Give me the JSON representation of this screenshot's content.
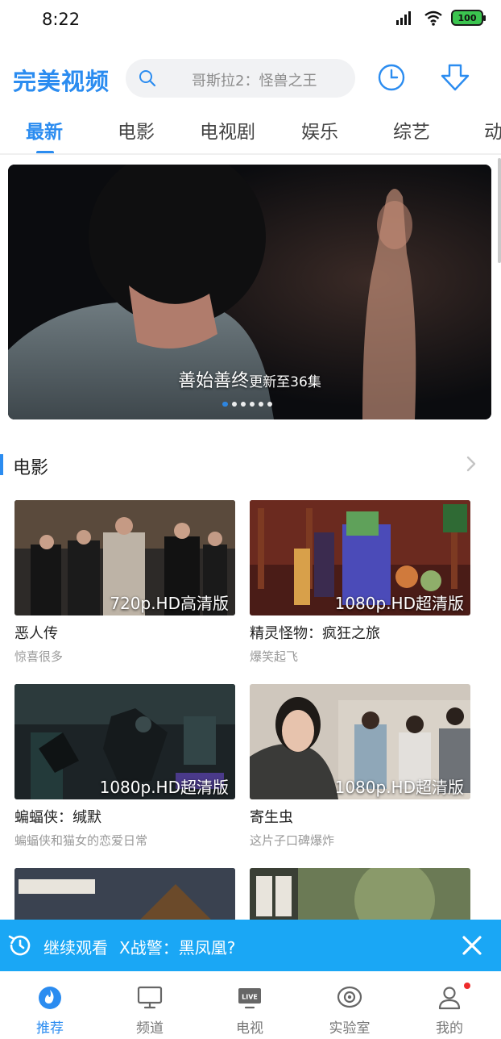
{
  "status_bar": {
    "time": "8:22",
    "battery": "100"
  },
  "header": {
    "app_title": "完美视频",
    "search_placeholder": "哥斯拉2：怪兽之王"
  },
  "tabs": [
    {
      "label": "最新",
      "active": true
    },
    {
      "label": "电影"
    },
    {
      "label": "电视剧"
    },
    {
      "label": "娱乐"
    },
    {
      "label": "综艺"
    },
    {
      "label": "动"
    }
  ],
  "banner": {
    "title": "善始善终",
    "subtitle": "更新至36集",
    "slide_count": 6,
    "active_slide": 1
  },
  "section": {
    "title": "电影"
  },
  "movies": [
    {
      "title": "恶人传",
      "subtitle": "惊喜很多",
      "quality": "720p.HD高清版"
    },
    {
      "title": "精灵怪物：疯狂之旅",
      "subtitle": "爆笑起飞",
      "quality": "1080p.HD超清版"
    },
    {
      "title": "蝙蝠侠：缄默",
      "subtitle": "蝙蝠侠和猫女的恋爱日常",
      "quality": "1080p.HD超清版"
    },
    {
      "title": "寄生虫",
      "subtitle": "这片子口碑爆炸",
      "quality": "1080p.HD超清版"
    }
  ],
  "continue_watching": {
    "label": "继续观看",
    "title": "X战警：黑凤凰?"
  },
  "bottom_nav": [
    {
      "label": "推荐",
      "icon": "flame-icon",
      "active": true
    },
    {
      "label": "频道",
      "icon": "monitor-icon"
    },
    {
      "label": "电视",
      "icon": "live-tv-icon",
      "badge_text": "LIVE"
    },
    {
      "label": "实验室",
      "icon": "eye-icon"
    },
    {
      "label": "我的",
      "icon": "user-icon",
      "has_notification": true
    }
  ],
  "colors": {
    "accent": "#2b8cf0",
    "continue_bar": "#1aa7f5",
    "notification": "#ee2b2b"
  }
}
